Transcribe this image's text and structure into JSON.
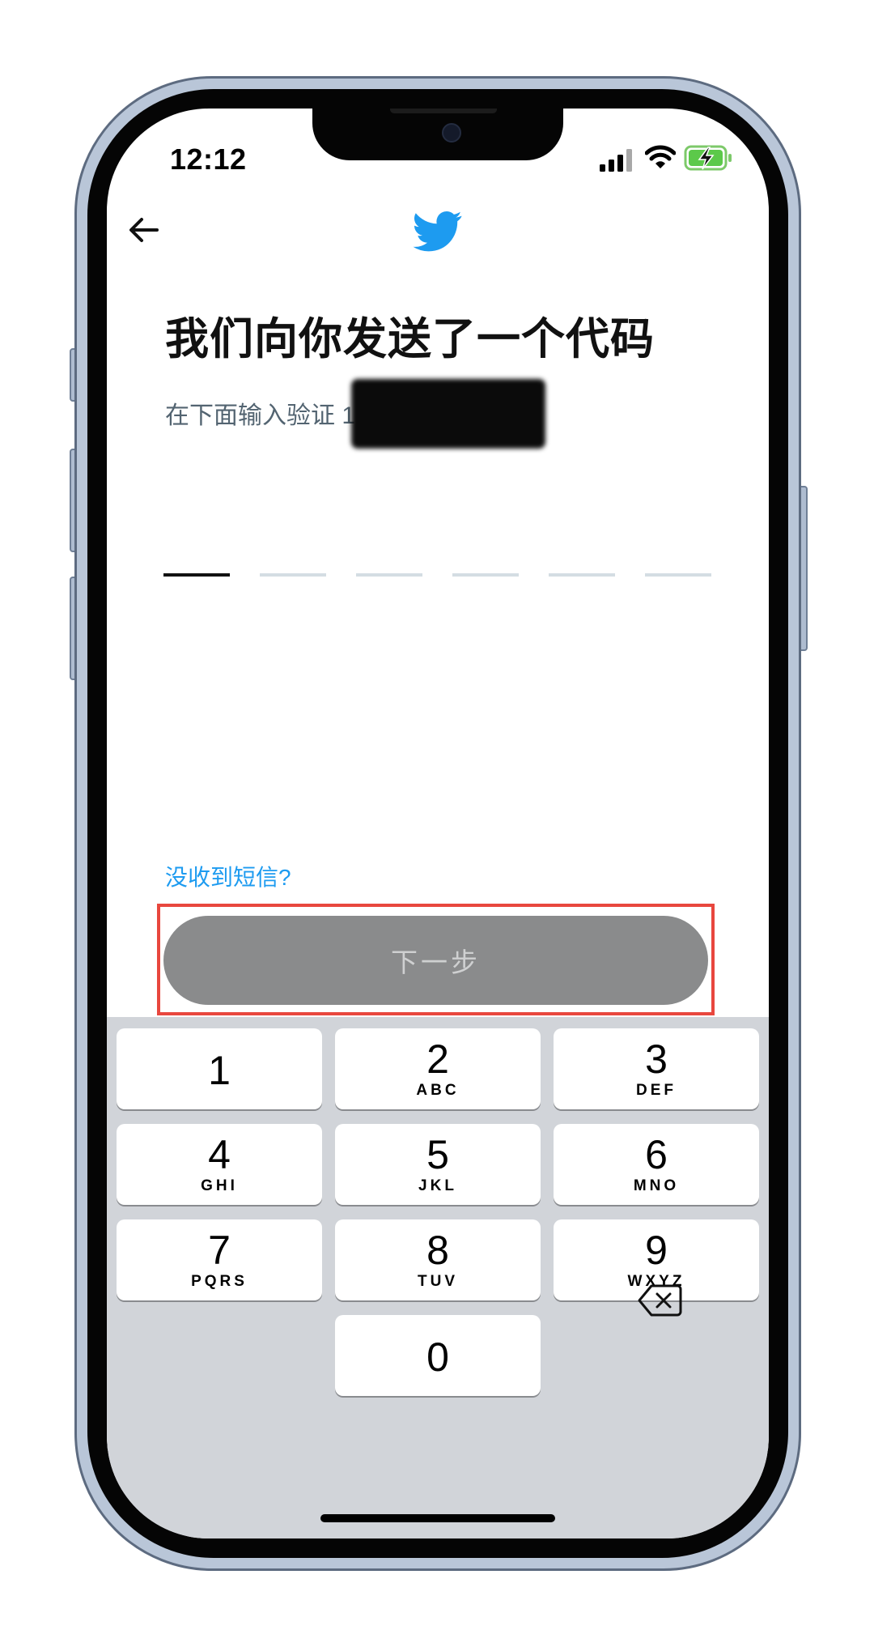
{
  "status_bar": {
    "time": "12:12"
  },
  "header": {
    "back_icon": "arrow-left-icon",
    "logo_icon": "twitter-bird-icon",
    "logo_color": "#1d9bf0"
  },
  "main": {
    "title": "我们向你发送了一个代码",
    "subtitle": "在下面输入验证 175 9123 2191。",
    "code_length": 6,
    "resend_link": "没收到短信?",
    "next_button": "下一步"
  },
  "keyboard": {
    "keys": [
      {
        "digit": "1",
        "letters": ""
      },
      {
        "digit": "2",
        "letters": "ABC"
      },
      {
        "digit": "3",
        "letters": "DEF"
      },
      {
        "digit": "4",
        "letters": "GHI"
      },
      {
        "digit": "5",
        "letters": "JKL"
      },
      {
        "digit": "6",
        "letters": "MNO"
      },
      {
        "digit": "7",
        "letters": "PQRS"
      },
      {
        "digit": "8",
        "letters": "TUV"
      },
      {
        "digit": "9",
        "letters": "WXYZ"
      },
      {
        "digit": "0",
        "letters": ""
      }
    ],
    "delete_icon": "backspace-icon"
  },
  "colors": {
    "accent": "#1d9bf0",
    "button_disabled": "#8a8b8c",
    "highlight": "#e8473e",
    "keyboard_bg": "#d1d4d9"
  }
}
